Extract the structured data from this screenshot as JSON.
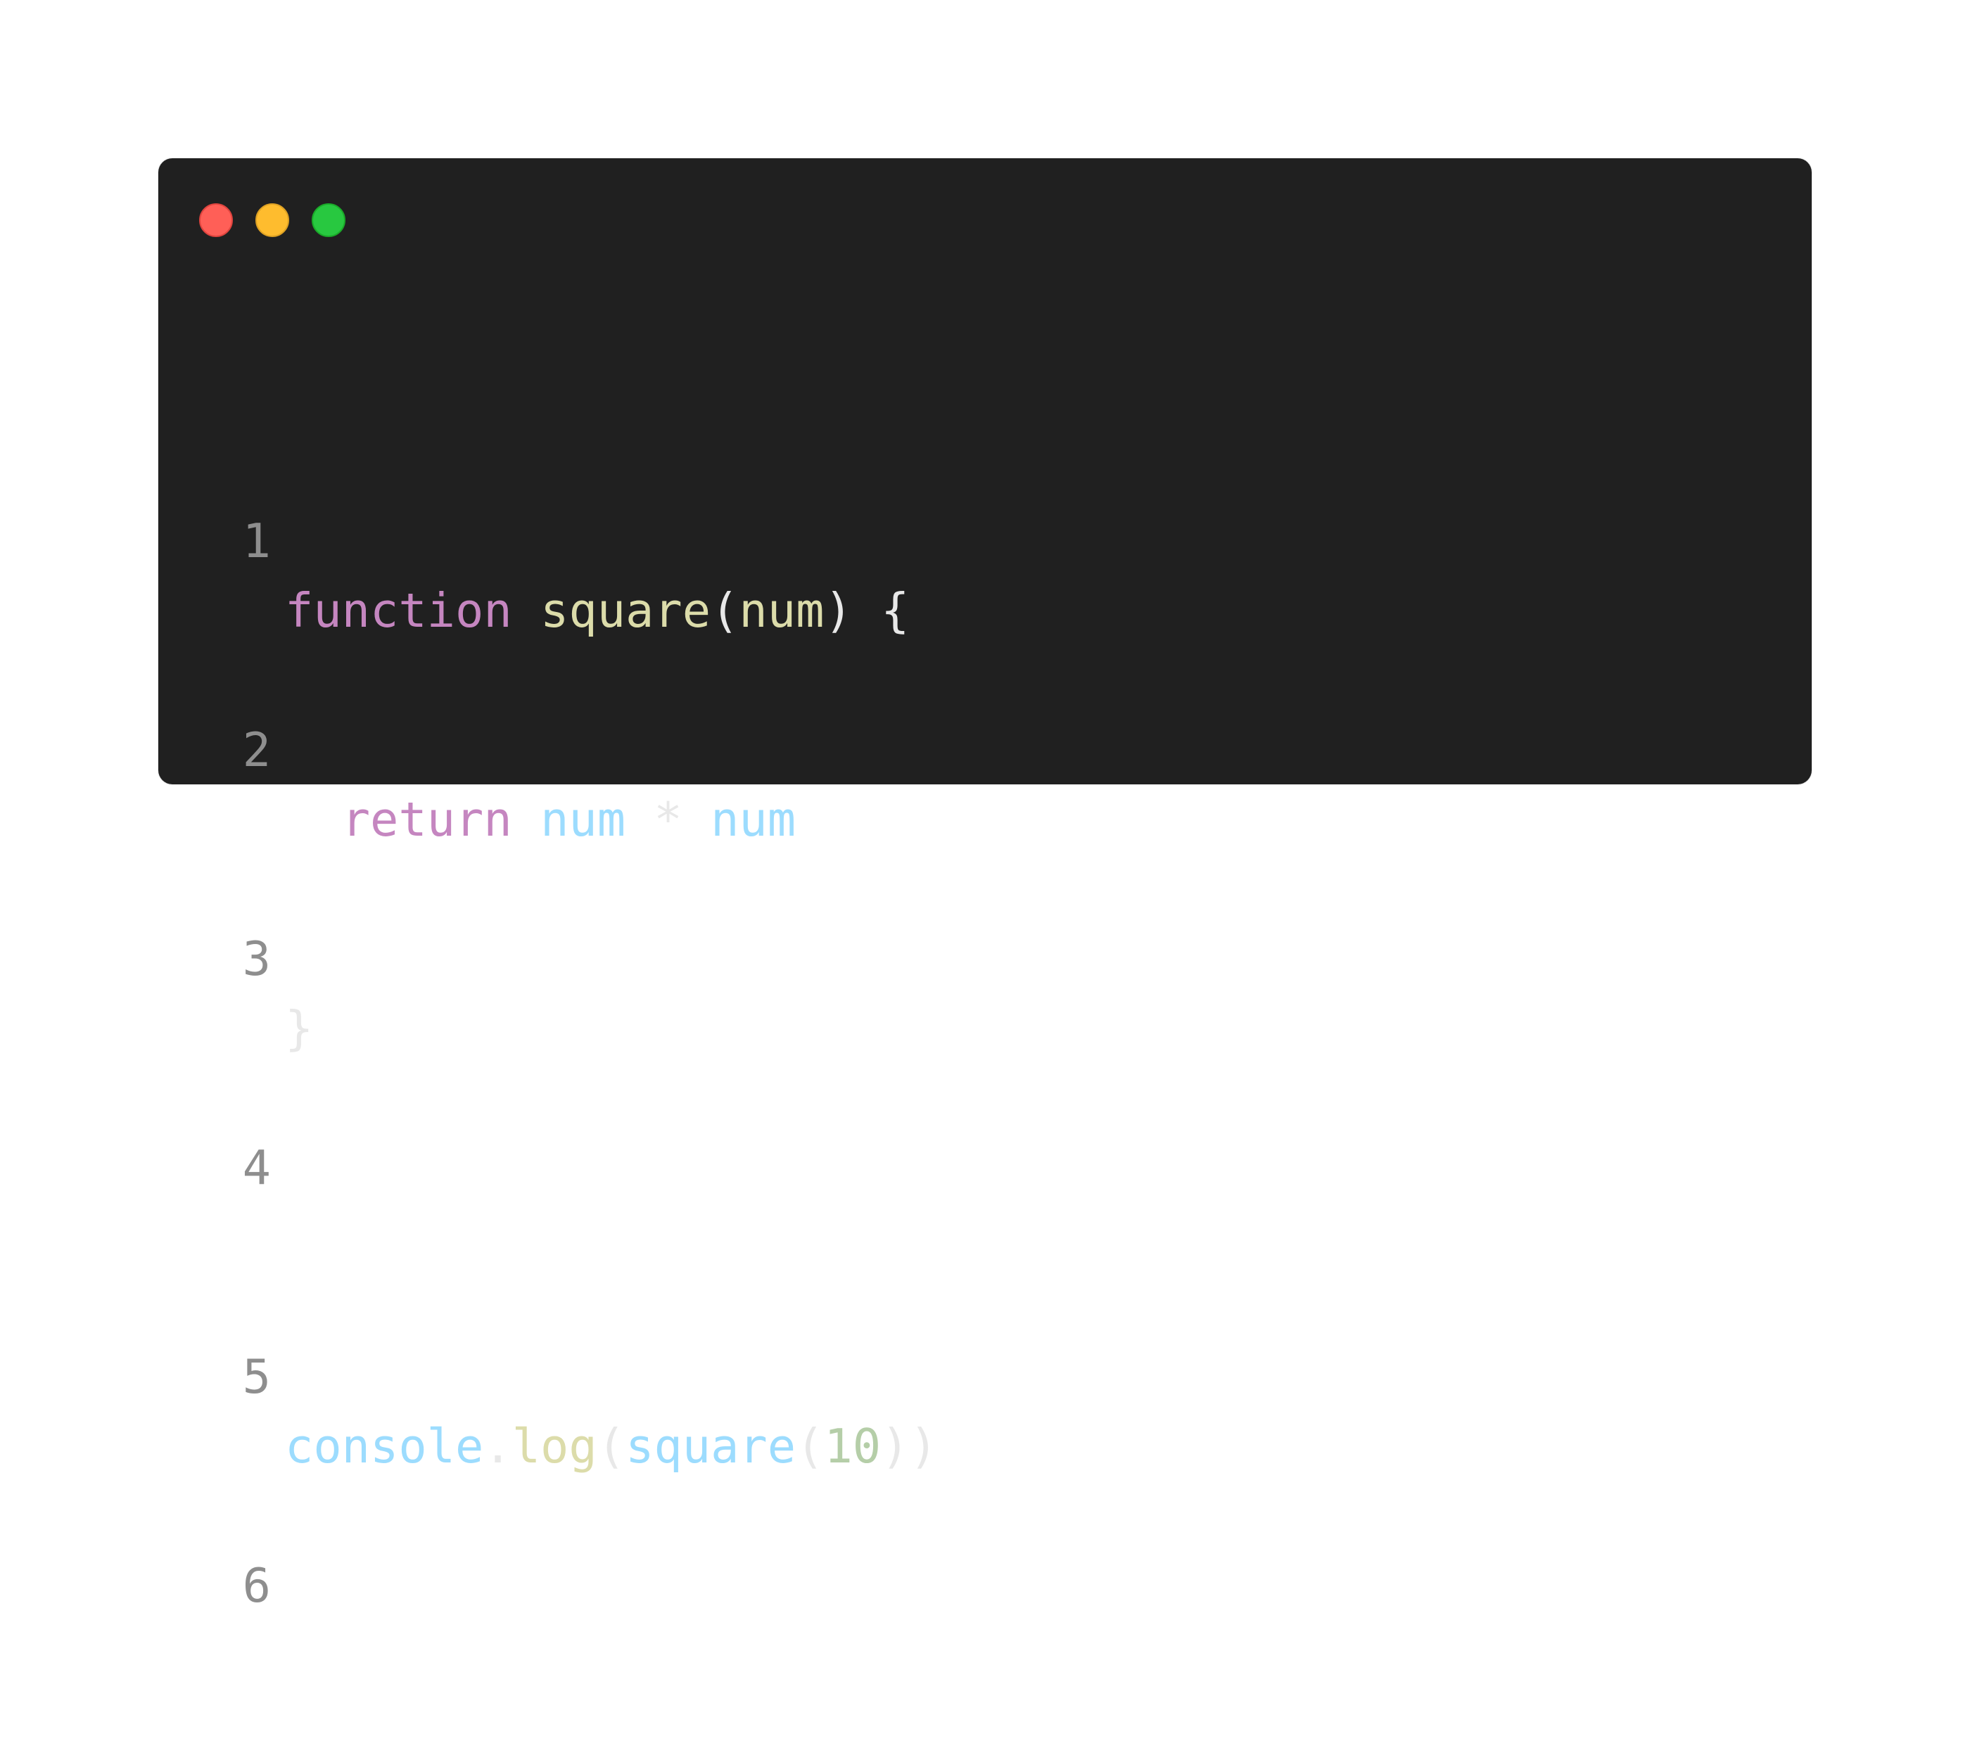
{
  "window": {
    "controls": [
      {
        "name": "close",
        "color": "#ff5f57",
        "border": "#e0443e"
      },
      {
        "name": "minimize",
        "color": "#febc2e",
        "border": "#dea123"
      },
      {
        "name": "maximize",
        "color": "#28c840",
        "border": "#1aab29"
      }
    ]
  },
  "theme": {
    "keyword": "#c586c0",
    "function": "#dcdcaa",
    "variable": "#9cdcfe",
    "number": "#b5cea8",
    "punctuation": "#e8e8e8",
    "line_number": "#8e8e8e"
  },
  "code": {
    "lines": [
      {
        "number": "1",
        "tokens": [
          {
            "text": "function",
            "kind": "keyword"
          },
          {
            "text": " ",
            "kind": "punctuation"
          },
          {
            "text": "square",
            "kind": "function"
          },
          {
            "text": "(",
            "kind": "punctuation"
          },
          {
            "text": "num",
            "kind": "function"
          },
          {
            "text": ") {",
            "kind": "punctuation"
          }
        ]
      },
      {
        "number": "2",
        "tokens": [
          {
            "text": "  ",
            "kind": "punctuation"
          },
          {
            "text": "return",
            "kind": "keyword"
          },
          {
            "text": " ",
            "kind": "punctuation"
          },
          {
            "text": "num",
            "kind": "variable"
          },
          {
            "text": " * ",
            "kind": "punctuation"
          },
          {
            "text": "num",
            "kind": "variable"
          }
        ]
      },
      {
        "number": "3",
        "tokens": [
          {
            "text": "}",
            "kind": "punctuation"
          }
        ]
      },
      {
        "number": "4",
        "tokens": []
      },
      {
        "number": "5",
        "tokens": [
          {
            "text": "console",
            "kind": "variable"
          },
          {
            "text": ".",
            "kind": "punctuation"
          },
          {
            "text": "log",
            "kind": "function"
          },
          {
            "text": "(",
            "kind": "punctuation"
          },
          {
            "text": "square",
            "kind": "variable"
          },
          {
            "text": "(",
            "kind": "punctuation"
          },
          {
            "text": "10",
            "kind": "number"
          },
          {
            "text": "))",
            "kind": "punctuation"
          }
        ]
      },
      {
        "number": "6",
        "tokens": []
      }
    ]
  }
}
